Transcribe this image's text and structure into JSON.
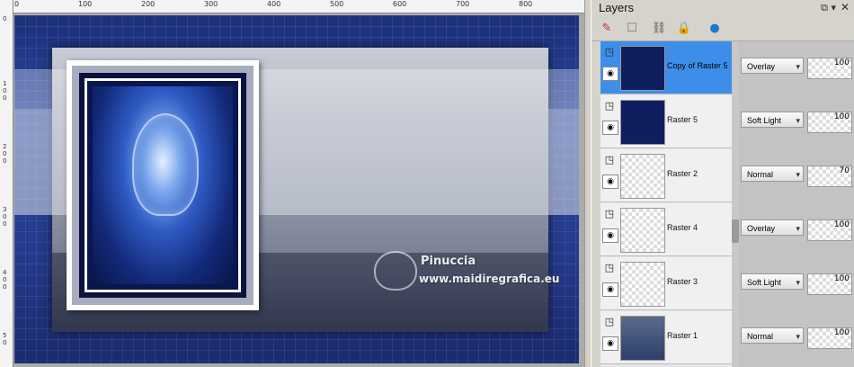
{
  "rulers": {
    "top": [
      "0",
      "100",
      "200",
      "300",
      "400",
      "500",
      "600",
      "700",
      "800"
    ],
    "left": [
      "0",
      "1",
      "0",
      "0",
      "2",
      "0",
      "0",
      "3",
      "0",
      "0",
      "4",
      "0",
      "0",
      "5",
      "0"
    ]
  },
  "watermark": {
    "name": "Pinuccia",
    "site": "www.maidiregrafica.eu"
  },
  "layers_panel": {
    "title": "Layers",
    "layers": [
      {
        "name": "Copy of Raster 5",
        "blend": "Overlay",
        "opacity": "100",
        "selected": true,
        "thumb": "dark"
      },
      {
        "name": "Raster 5",
        "blend": "Soft Light",
        "opacity": "100",
        "selected": false,
        "thumb": "dark"
      },
      {
        "name": "Raster 2",
        "blend": "Normal",
        "opacity": "70",
        "selected": false,
        "thumb": "check"
      },
      {
        "name": "Raster 4",
        "blend": "Overlay",
        "opacity": "100",
        "selected": false,
        "thumb": "check"
      },
      {
        "name": "Raster 3",
        "blend": "Soft Light",
        "opacity": "100",
        "selected": false,
        "thumb": "check"
      },
      {
        "name": "Raster 1",
        "blend": "Normal",
        "opacity": "100",
        "selected": false,
        "thumb": "photo"
      }
    ]
  },
  "colors": {
    "selection": "#3d8ee8",
    "canvas_blue": "#24398a"
  }
}
